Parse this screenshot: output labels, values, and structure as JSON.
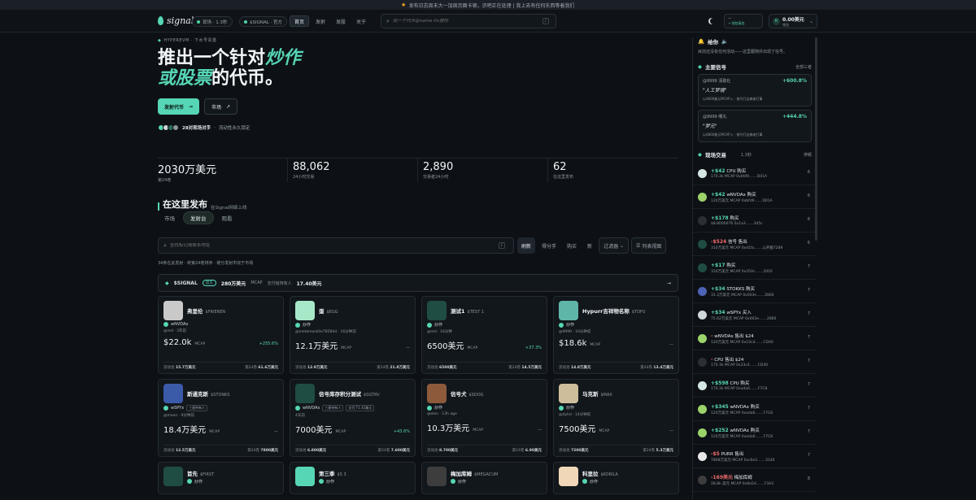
{
  "announcement": "发布日志周末大一加周页面卡顿，识吧正在处理 | 我上去有任何东西等着我们",
  "brand": {
    "name": "signal",
    "market": "现场 · 1.3秒",
    "signal_pill": "$SIGNAL · 官方"
  },
  "nav": [
    "首页",
    "发射",
    "发股",
    "关于"
  ],
  "search_placeholder": "找一个代币@name 0x搜你",
  "search_key": "/",
  "wallet": {
    "label": "一",
    "action": "→ 钱包接金"
  },
  "balance": {
    "avatar": "R",
    "value": "0.00美元",
    "sub": "钱包"
  },
  "hero": {
    "tag": "HYPEREVM · 下水号贵勇",
    "line1": "推出一个针对",
    "line1_accent": "炒作",
    "line2_accent": "或股票",
    "line2": "的代币。",
    "btn_primary": "发射代币",
    "btn_secondary": "市场",
    "social_count": "28对现场对手",
    "social_sep": "·",
    "social_note": "流动性永久锁定"
  },
  "stats": [
    {
      "value": "2030万美元",
      "label": "第24卷"
    },
    {
      "value": "88,062",
      "label": "24小时交易"
    },
    {
      "value": "2,890",
      "label": "交易者24小时"
    },
    {
      "value": "62",
      "label": "在这里发布"
    }
  ],
  "section": {
    "title": "在这里发布",
    "subtitle": "在Signal网络上线"
  },
  "tabs": [
    "市场",
    "发射台",
    "观看"
  ],
  "list_search_placeholder": "查找标记或联系地址",
  "list_search_key": "/",
  "filters": [
    "刷新",
    "得分手",
    "购买",
    "新",
    "过滤器",
    "列表视图"
  ],
  "hint": "34条在此发射 · 统第24卷排序 · 被分发射市完于市场",
  "banner": {
    "ticker": "$SIGNAL",
    "badge": "官方",
    "mcap": "280万美元",
    "mcap_unit": "MCAP",
    "holders_label": "支付给持有人",
    "holders": "17.40美元"
  },
  "cards": [
    {
      "name": "弗里伦",
      "ticker": "$FRIEREN",
      "tag": "wNVDAx",
      "meta": "@red · 3年前",
      "mcap": "$22.0k",
      "unit": "MCAP",
      "change": "+255.6%",
      "dir": "up",
      "liq_label": "流动池",
      "liq": "15.7万美元",
      "vol_label": "第24卷",
      "vol": "61.6万美元",
      "color": "#c9c9c9"
    },
    {
      "name": "蛋",
      "ticker": "$EGG",
      "tag": "炒作",
      "meta": "@metamask0x7B58dd · 16分钟前",
      "mcap": "12.1万美元",
      "unit": "MCAP",
      "change": "—",
      "dir": "flat",
      "liq_label": "流动池",
      "liq": "12.9万美元",
      "vol_label": "第24卷",
      "vol": "21.8万美元",
      "color": "#a7e8c8"
    },
    {
      "name": "测试1",
      "ticker": "$TEST 1",
      "tag": "炒作",
      "meta": "@red · 16分钟",
      "mcap": "6500美元",
      "unit": "MCAP",
      "change": "+37.3%",
      "dir": "up",
      "liq_label": "流动池",
      "liq": "6500美元",
      "vol_label": "第24卷",
      "vol": "14.5万美元",
      "color": "#1f4d43"
    },
    {
      "name": "Hypurr吉祥物名称",
      "ticker": "$TOFU",
      "tag": "炒作",
      "meta": "@9999 · 16分钟前",
      "mcap": "$18.6k",
      "unit": "MCAP",
      "change": "—",
      "dir": "flat",
      "liq_label": "流动池",
      "liq": "14.8万美元",
      "vol_label": "第24卷",
      "vol": "13.4万美元",
      "color": "#5fb6a8"
    },
    {
      "name": "斯通克斯",
      "ticker": "$STONKS",
      "tag": "wSPYx",
      "tag_label": "三星持有人",
      "meta": "@moon · 9分钟前",
      "mcap": "18.4万美元",
      "unit": "MCAP",
      "change": "—",
      "dir": "flat",
      "liq_label": "流动池",
      "liq": "12.5万美元",
      "vol_label": "第24卷",
      "vol": "7800美元",
      "color": "#3b5aa8"
    },
    {
      "name": "信号库存积分测试",
      "ticker": "$SGTRV",
      "tag": "wNVDAx",
      "tag_label": "三星持有人",
      "tag_label2": "支付了1.41美元",
      "meta": "4天前",
      "mcap": "7000美元",
      "unit": "MCAP",
      "change": "+43.6%",
      "dir": "up",
      "liq_label": "流动池",
      "liq": "6.800美元",
      "vol_label": "第24卷",
      "vol": "7.600美元",
      "color": "#1f4d43"
    },
    {
      "name": "信号犬",
      "ticker": "$SDOG",
      "tag": "炒作",
      "meta": "@elon · 13h ago",
      "mcap": "10.3万美元",
      "unit": "MCAP",
      "change": "—",
      "dir": "flat",
      "liq_label": "流动池",
      "liq": "8.700美元",
      "vol_label": "第24卷",
      "vol": "6.90美元",
      "color": "#8d5a3c"
    },
    {
      "name": "马克斯",
      "ticker": "$MAX",
      "tag": "炒作",
      "meta": "@dyhd · 14分钟前",
      "mcap": "7500美元",
      "unit": "MCAP",
      "change": "—",
      "dir": "flat",
      "liq_label": "流动池",
      "liq": "7200美元",
      "vol_label": "第24卷",
      "vol": "5.3万美元",
      "color": "#cdbd9a"
    },
    {
      "name": "首先",
      "ticker": "$FIRST",
      "tag": "炒作",
      "color": "#1f4d43"
    },
    {
      "name": "第三季",
      "ticker": "$S 3",
      "tag": "炒作",
      "color": "#56d6b5"
    },
    {
      "name": "梅加库姆",
      "ticker": "$MEGACUM",
      "tag": "炒作",
      "color": "#3d3d3d"
    },
    {
      "name": "科里拉",
      "ticker": "$KORILA",
      "tag": "炒作",
      "color": "#f0d7b8"
    }
  ],
  "sidebar": {
    "alert_title": "给你",
    "alert_text": "目前还没有任何活动——这里跟随并出现了信号。",
    "signals_title": "主要信号",
    "signals_all": "全部三者",
    "signals": [
      {
        "user": "@9999 清取社",
        "change": "+600.8%",
        "quote": "\"人工梦境\"",
        "meta": "以4800美元MCAP入 · 借号打这做者打事"
      },
      {
        "user": "@9999 哪丸",
        "change": "+444.8%",
        "quote": "\"梦元\"",
        "meta": "以4800美元MCAP入 · 借号打这做者打事"
      }
    ],
    "trades_title": "现场交易",
    "trades_time": "1.3秒",
    "trades_pause": "停顿",
    "trades": [
      {
        "amt": "+$42",
        "tok": "CPU",
        "act": "购买",
        "l2": "170.3k  MCAP  0xbfd9.......D01A",
        "n": "6",
        "dir": "up",
        "color": "#d5e7e2"
      },
      {
        "amt": "+$42",
        "tok": "wNVDAx",
        "act": "购买",
        "l2": "120万美元  MCAP  0xbfd9.......D01A",
        "n": "6",
        "dir": "up",
        "color": "#9bd36a"
      },
      {
        "amt": "+$178",
        "tok": "",
        "act": "购买",
        "l2": "$8.8000076  0x1a3.......3d5c",
        "n": "6",
        "dir": "up",
        "color": "#2b2f35"
      },
      {
        "amt": "-$524",
        "tok": "信号",
        "act": "售出",
        "l2": "310万美元  MCAP  0xd1fa.......公开额7289",
        "n": "6",
        "dir": "down",
        "color": "#1f4d43"
      },
      {
        "amt": "+$17",
        "tok": "",
        "act": "购买",
        "l2": "310万美元  MCAP  0x350c.......2002",
        "n": "7",
        "dir": "up",
        "color": "#1f4d43"
      },
      {
        "amt": "+$34",
        "tok": "STOKKS",
        "act": "购买",
        "l2": "31.3万美元  MCAP  0x003e.......2860",
        "n": "7",
        "dir": "up",
        "color": "#4e63b5"
      },
      {
        "amt": "+$34",
        "tok": "wSPYx",
        "act": "买入",
        "l2": "75.62万美元  MCAP  0x003e.......2860",
        "n": "7",
        "dir": "up",
        "color": "#cfd7dd"
      },
      {
        "amt": "-",
        "tok": "wNVDAx",
        "act": "售出 $24",
        "l2": "120万美元  MCAP  0x23c4.......CD40",
        "n": "7",
        "dir": "down",
        "color": "#9bd36a"
      },
      {
        "amt": "-",
        "tok": "CPU",
        "act": "售出 $24",
        "l2": "170.3k  MCAP  0x23c4.......CD40",
        "n": "7",
        "dir": "down",
        "color": "#2b2f35"
      },
      {
        "amt": "+$598",
        "tok": "CPU",
        "act": "购买",
        "l2": "170.3k  MCAP  0xada6.......F7C8",
        "n": "7",
        "dir": "up",
        "color": "#d5e7e2"
      },
      {
        "amt": "+$345",
        "tok": "wNVDAx",
        "act": "购买",
        "l2": "120万美元  MCAP  0xada6.......F7C8",
        "n": "7",
        "dir": "up",
        "color": "#9bd36a"
      },
      {
        "amt": "+$252",
        "tok": "wNVDAx",
        "act": "购买",
        "l2": "120万美元  MCAP  0xada6.......F7C8",
        "n": "7",
        "dir": "up",
        "color": "#9bd36a"
      },
      {
        "amt": "-$5",
        "tok": "PURR",
        "act": "售出",
        "l2": "7868万美元  MCAP  0xc0e2.......3146",
        "n": "7",
        "dir": "down",
        "color": "#e8e8e8"
      },
      {
        "amt": "-169美元",
        "tok": "",
        "act": "梅加库姆",
        "l2": "28.8k  美元  MCAP  0x8a5d.......F3A3",
        "n": "8",
        "dir": "down",
        "color": "#3d3d3d"
      }
    ]
  }
}
